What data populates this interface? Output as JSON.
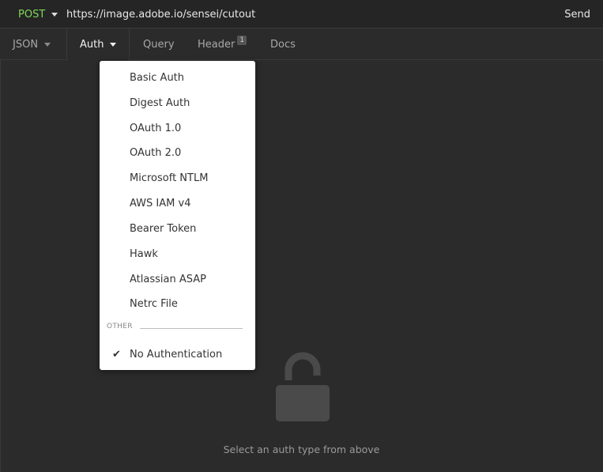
{
  "request": {
    "method": "POST",
    "url": "https://image.adobe.io/sensei/cutout",
    "send_label": "Send"
  },
  "tabs": [
    {
      "label": "JSON",
      "has_dropdown": true,
      "active": false
    },
    {
      "label": "Auth",
      "has_dropdown": true,
      "active": true
    },
    {
      "label": "Query",
      "has_dropdown": false,
      "active": false
    },
    {
      "label": "Header",
      "badge": "1",
      "has_dropdown": false,
      "active": false
    },
    {
      "label": "Docs",
      "has_dropdown": false,
      "active": false
    }
  ],
  "auth_menu": {
    "items": [
      {
        "label": "Basic Auth"
      },
      {
        "label": "Digest Auth"
      },
      {
        "label": "OAuth 1.0"
      },
      {
        "label": "OAuth 2.0"
      },
      {
        "label": "Microsoft NTLM"
      },
      {
        "label": "AWS IAM v4"
      },
      {
        "label": "Bearer Token"
      },
      {
        "label": "Hawk"
      },
      {
        "label": "Atlassian ASAP"
      },
      {
        "label": "Netrc File"
      }
    ],
    "section_label": "OTHER",
    "other_items": [
      {
        "label": "No Authentication",
        "checked": true
      }
    ]
  },
  "empty_state": {
    "icon": "unlock-icon",
    "message": "Select an auth type from above"
  },
  "colors": {
    "method": "#7ed957",
    "background": "#2b2b2b",
    "menu_background": "#ffffff"
  }
}
